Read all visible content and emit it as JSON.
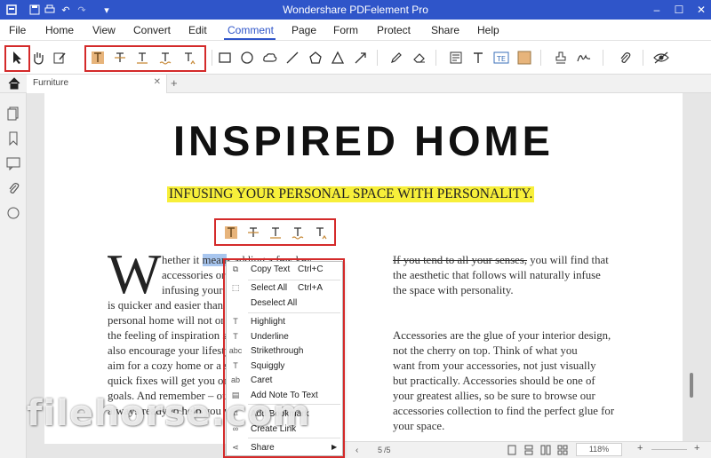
{
  "titlebar": {
    "title": "Wondershare PDFelement Pro"
  },
  "menu": {
    "items": [
      "File",
      "Home",
      "View",
      "Convert",
      "Edit",
      "Comment",
      "Page",
      "Form",
      "Protect",
      "Share",
      "Help"
    ],
    "active": "Comment"
  },
  "tab": {
    "label": "Furniture"
  },
  "document": {
    "heading": "INSPIRED HOME",
    "subheading": "INFUSING YOUR PERSONAL SPACE WITH PERSONALITY.",
    "dropcap": "W",
    "left_lines": [
      "hether it",
      "accessories or",
      "infusing your",
      "is quicker and easier than",
      "personal home will not or",
      "the feeling of inspiration s",
      "also encourage your lifesty",
      "aim for a cozy home or a s",
      "quick fixes will get you on",
      "goals. And remember – ou",
      "always ready to help you wi"
    ],
    "left_line1_hl": "mean",
    "left_line1_rest": "s adding a few key",
    "right_p1_strike": "If you tend to all your senses,",
    "right_p1_rest": " you will find that",
    "right_p1_lines": [
      "the aesthetic that follows will naturally infuse",
      "the space with personality."
    ],
    "right_p2_lines": [
      "Accessories are the glue of your interior design,",
      "not the cherry on top. Think of what you",
      "want from your accessories, not just visually",
      "but practically. Accessories should be one of",
      "your greatest allies, so be sure to browse our",
      "accessories collection to find the perfect glue for",
      "your space."
    ]
  },
  "context_menu": {
    "items": [
      {
        "label": "Copy Text",
        "shortcut": "Ctrl+C"
      },
      {
        "label": "Select All",
        "shortcut": "Ctrl+A"
      },
      {
        "label": "Deselect All",
        "shortcut": ""
      },
      {
        "label": "Highlight",
        "shortcut": ""
      },
      {
        "label": "Underline",
        "shortcut": ""
      },
      {
        "label": "Strikethrough",
        "shortcut": ""
      },
      {
        "label": "Squiggly",
        "shortcut": ""
      },
      {
        "label": "Caret",
        "shortcut": ""
      },
      {
        "label": "Add Note To Text",
        "shortcut": ""
      },
      {
        "label": "Add Bookmark",
        "shortcut": ""
      },
      {
        "label": "Create Link",
        "shortcut": ""
      },
      {
        "label": "Share",
        "shortcut": ""
      }
    ]
  },
  "status": {
    "page": "5",
    "total": "/5",
    "zoom": "118%"
  },
  "watermark": "filehorse.com",
  "colors": {
    "accent": "#2f55c9",
    "highlight_box": "#d42a2a",
    "text_highlight": "#f7ef3a",
    "selection": "#a8c6ef"
  }
}
